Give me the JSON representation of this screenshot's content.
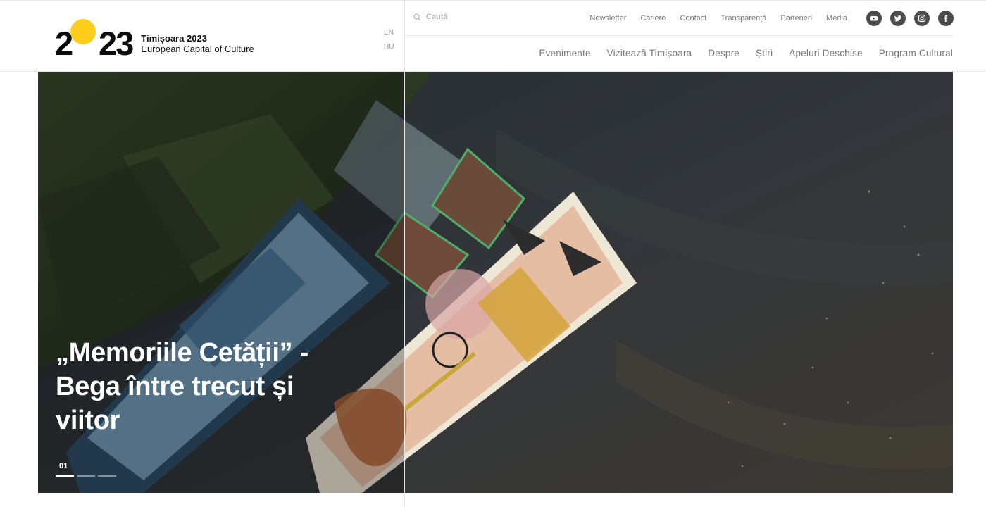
{
  "logo": {
    "digit_left": "2",
    "digits_right": "23",
    "title": "Timișoara 2023",
    "subtitle": "European Capital of Culture",
    "sun_color": "#ffcd1c"
  },
  "languages": [
    "EN",
    "HU"
  ],
  "search": {
    "placeholder": "Caută",
    "icon": "search-icon"
  },
  "top_links": [
    "Newsletter",
    "Cariere",
    "Contact",
    "Transparență",
    "Parteneri",
    "Media"
  ],
  "socials": [
    {
      "name": "youtube",
      "icon": "youtube-icon",
      "glyph": "You"
    },
    {
      "name": "twitter",
      "icon": "twitter-icon"
    },
    {
      "name": "instagram",
      "icon": "instagram-icon"
    },
    {
      "name": "facebook",
      "icon": "facebook-icon",
      "glyph": "f"
    }
  ],
  "main_nav": [
    "Evenimente",
    "Vizitează Timișoara",
    "Despre",
    "Știri",
    "Apeluri Deschise",
    "Program Cultural"
  ],
  "hero": {
    "title_line1": "„Memoriile Cetății” -",
    "title_line2": "Bega între trecut și",
    "title_line3": "viitor",
    "slides": [
      {
        "label": "01",
        "active": true
      },
      {
        "label": "",
        "active": false
      },
      {
        "label": "",
        "active": false
      }
    ]
  },
  "colors": {
    "accent": "#ffcd1c",
    "nav_text": "#777777",
    "social_bg": "#4b4b4b"
  }
}
